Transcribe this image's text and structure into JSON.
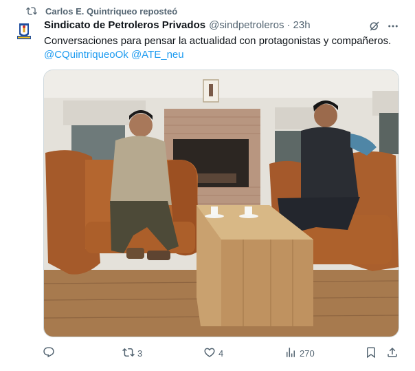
{
  "repost": {
    "text": "Carlos E. Quintriqueo reposteó",
    "icon": "repost-icon"
  },
  "author": {
    "name": "Sindicato de Petroleros Privados",
    "handle": "@sindpetroleros",
    "separator": "·",
    "time": "23h"
  },
  "tweet": {
    "text": "Conversaciones para pensar la actualidad con protagonistas y compañeros.",
    "mentions": [
      "@CQuintriqueoOk",
      "@ATE_neu"
    ]
  },
  "media": {
    "icon": "photo"
  },
  "actions": {
    "reply": {
      "icon": "reply-icon",
      "count": ""
    },
    "retweet": {
      "icon": "retweet-icon",
      "count": "3"
    },
    "like": {
      "icon": "heart-icon",
      "count": "4"
    },
    "views": {
      "icon": "views-icon",
      "count": "270"
    },
    "bookmark": {
      "icon": "bookmark-icon"
    },
    "share": {
      "icon": "share-icon"
    }
  },
  "colors": {
    "accent": "#1d9bf0",
    "secondary": "#536471",
    "text": "#0f1419"
  }
}
